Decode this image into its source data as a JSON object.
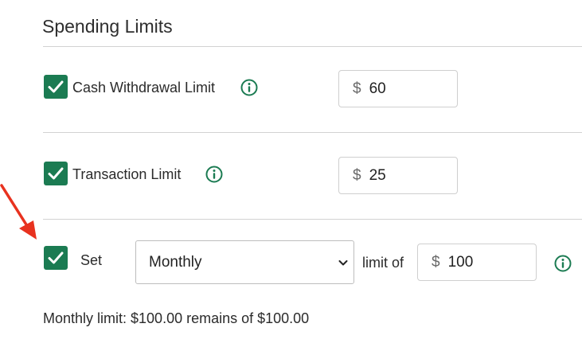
{
  "title": "Spending Limits",
  "rows": [
    {
      "checked": true,
      "label": "Cash Withdrawal Limit",
      "currency": "$",
      "value": "60"
    },
    {
      "checked": true,
      "label": "Transaction Limit",
      "currency": "$",
      "value": "25"
    }
  ],
  "period_row": {
    "checked": true,
    "set_label": "Set",
    "period_selected": "Monthly",
    "limit_of_label": "limit of",
    "currency": "$",
    "value": "100"
  },
  "summary": "Monthly limit: $100.00 remains of $100.00",
  "colors": {
    "accent": "#1b7b52",
    "annotation_arrow": "#e8321f"
  },
  "icons": {
    "check": "check-icon",
    "info": "info-icon",
    "dropdown": "chevron-down-icon",
    "arrow": "arrow-icon"
  }
}
